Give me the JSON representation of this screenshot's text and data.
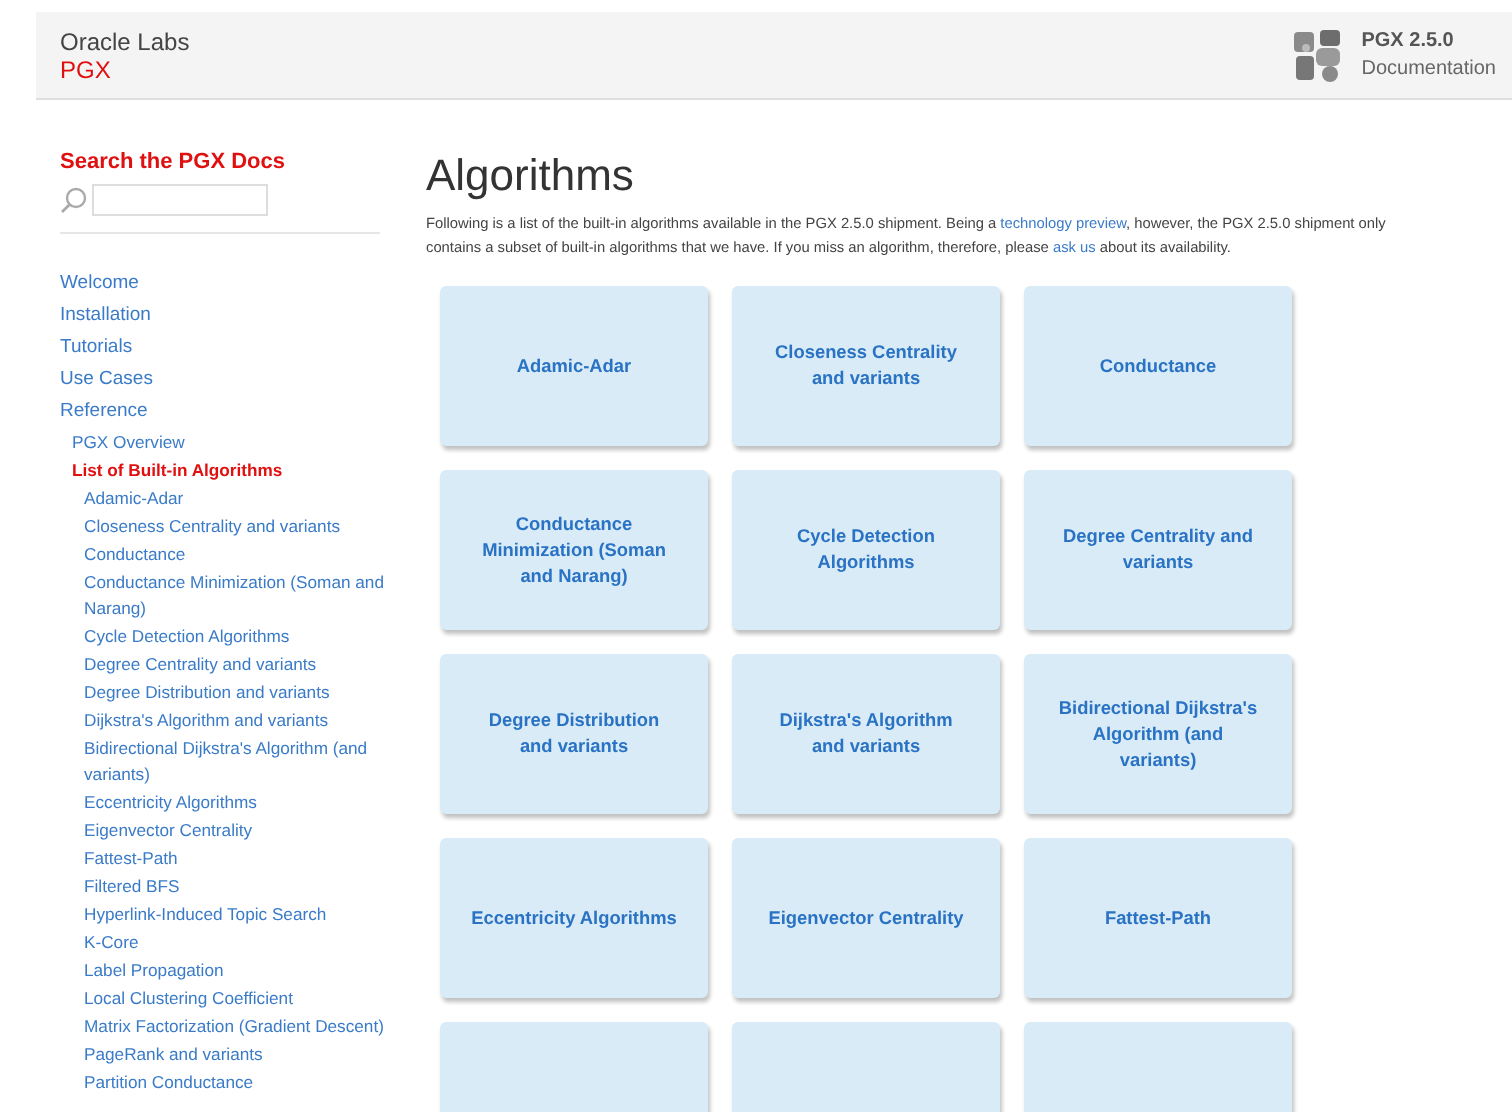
{
  "header": {
    "brand": "Oracle Labs",
    "product": "PGX",
    "version": "PGX 2.5.0",
    "subtitle": "Documentation"
  },
  "sidebar": {
    "search_heading": "Search the PGX Docs",
    "nav": [
      {
        "label": "Welcome",
        "selected": false
      },
      {
        "label": "Installation",
        "selected": false
      },
      {
        "label": "Tutorials",
        "selected": false
      },
      {
        "label": "Use Cases",
        "selected": false
      },
      {
        "label": "Reference",
        "selected": false,
        "children": [
          {
            "label": "PGX Overview",
            "selected": false
          },
          {
            "label": "List of Built-in Algorithms",
            "selected": true,
            "children": [
              {
                "label": "Adamic-Adar",
                "selected": false
              },
              {
                "label": "Closeness Centrality and variants",
                "selected": false
              },
              {
                "label": "Conductance",
                "selected": false
              },
              {
                "label": "Conductance Minimization (Soman and Narang)",
                "selected": false
              },
              {
                "label": "Cycle Detection Algorithms",
                "selected": false
              },
              {
                "label": "Degree Centrality and variants",
                "selected": false
              },
              {
                "label": "Degree Distribution and variants",
                "selected": false
              },
              {
                "label": "Dijkstra's Algorithm and variants",
                "selected": false
              },
              {
                "label": "Bidirectional Dijkstra's Algorithm (and variants)",
                "selected": false
              },
              {
                "label": "Eccentricity Algorithms",
                "selected": false
              },
              {
                "label": "Eigenvector Centrality",
                "selected": false
              },
              {
                "label": "Fattest-Path",
                "selected": false
              },
              {
                "label": "Filtered BFS",
                "selected": false
              },
              {
                "label": "Hyperlink-Induced Topic Search",
                "selected": false
              },
              {
                "label": "K-Core",
                "selected": false
              },
              {
                "label": "Label Propagation",
                "selected": false
              },
              {
                "label": "Local Clustering Coefficient",
                "selected": false
              },
              {
                "label": "Matrix Factorization (Gradient Descent)",
                "selected": false
              },
              {
                "label": "PageRank and variants",
                "selected": false
              },
              {
                "label": "Partition Conductance",
                "selected": false
              }
            ]
          }
        ]
      }
    ]
  },
  "main": {
    "title": "Algorithms",
    "intro": [
      "Following is a list of the built-in algorithms available in the PGX 2.5.0 shipment. Being a ",
      "technology preview",
      ", however, the PGX 2.5.0 shipment only contains a subset of built-in algorithms that we have. If you miss an algorithm, therefore, please ",
      "ask us",
      " about its availability."
    ],
    "cards": [
      {
        "label": "Adamic-Adar"
      },
      {
        "label": "Closeness Centrality and variants"
      },
      {
        "label": "Conductance"
      },
      {
        "label": "Conductance Minimization (Soman and Narang)"
      },
      {
        "label": "Cycle Detection Algorithms"
      },
      {
        "label": "Degree Centrality and variants"
      },
      {
        "label": "Degree Distribution and variants"
      },
      {
        "label": "Dijkstra's Algorithm and variants"
      },
      {
        "label": "Bidirectional Dijkstra's Algorithm (and variants)"
      },
      {
        "label": "Eccentricity Algorithms"
      },
      {
        "label": "Eigenvector Centrality"
      },
      {
        "label": "Fattest-Path"
      },
      {
        "kind": "blank"
      },
      {
        "kind": "blank"
      },
      {
        "kind": "blank"
      }
    ]
  }
}
